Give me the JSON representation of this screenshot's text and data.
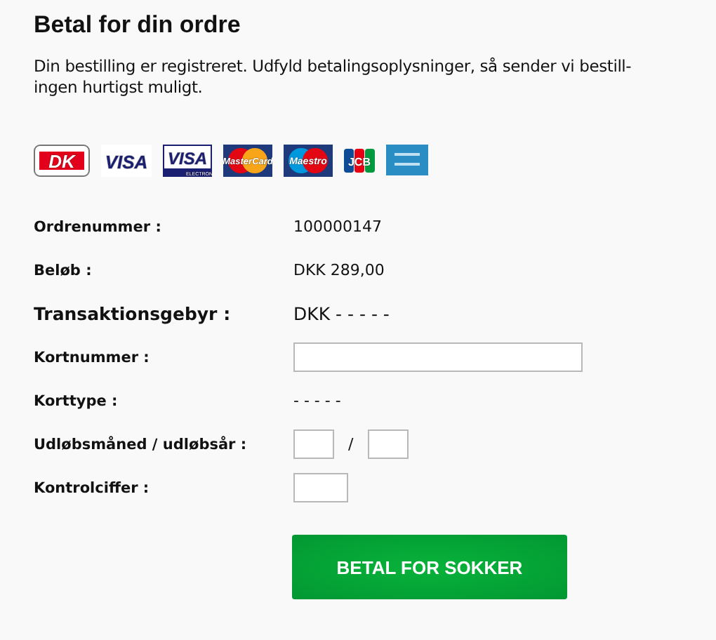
{
  "title": "Betal for din ordre",
  "intro_lines": [
    "Din bestilling er registreret. Udfyld betalingsoplysninger, så sender vi bestill-",
    "ingen hurtigst muligt."
  ],
  "card_logos": [
    {
      "kind": "dk",
      "text": "DK"
    },
    {
      "kind": "visa",
      "text": "VISA"
    },
    {
      "kind": "electron",
      "text": "VISA",
      "subtext": "ELECTRON"
    },
    {
      "kind": "mastercard",
      "text": "MasterCard"
    },
    {
      "kind": "maestro",
      "text": "Maestro"
    },
    {
      "kind": "jcb",
      "text": "JCB"
    },
    {
      "kind": "amex"
    }
  ],
  "rows": [
    {
      "kind": "text",
      "label": "Ordrenummer :",
      "value": "100000147",
      "large": false
    },
    {
      "kind": "text",
      "label": "Beløb :",
      "value": "DKK 289,00",
      "large": false
    },
    {
      "kind": "text",
      "label": "Transaktionsgebyr :",
      "value": "DKK - - - - -",
      "large": true
    },
    {
      "kind": "wide_input",
      "label": "Kortnummer :"
    },
    {
      "kind": "text",
      "label": "Korttype :",
      "value": "- - - - -",
      "large": false
    },
    {
      "kind": "expiry",
      "label": "Udløbsmåned / udløbsår :",
      "separator": "/"
    },
    {
      "kind": "small_input",
      "label": "Kontrolciffer :"
    }
  ],
  "pay_button": "BETAL FOR SOKKER"
}
